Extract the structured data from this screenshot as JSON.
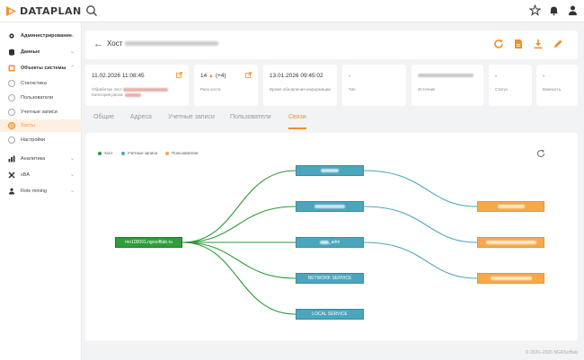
{
  "app": {
    "name": "DATAPLAN"
  },
  "header": {
    "title_prefix": "Хост"
  },
  "sidebar": {
    "items": [
      {
        "label": "Администрирование"
      },
      {
        "label": "Данные"
      },
      {
        "label": "Объекты системы"
      },
      {
        "label": "Статистика"
      },
      {
        "label": "Пользователи"
      },
      {
        "label": "Учетные записи"
      },
      {
        "label": "Хосты"
      },
      {
        "label": "Настройки"
      },
      {
        "label": "Аналитика"
      },
      {
        "label": "xBA"
      },
      {
        "label": "Role mining"
      }
    ]
  },
  "info": {
    "processed": {
      "value": "11.02.2026 11:08:45",
      "label": "Обработан лист",
      "label2": "Категория риска:"
    },
    "risk": {
      "value": "14",
      "delta": "(+4)",
      "label": "Риск хоста"
    },
    "updated": {
      "value": "13.01.2026 09:45:02",
      "label": "Время обновления информации"
    },
    "type": {
      "value": "-",
      "label": "Тип"
    },
    "source": {
      "label": "Источник"
    },
    "status": {
      "value": "-",
      "label": "Статус"
    },
    "importance": {
      "value": "-",
      "label": "Важность"
    }
  },
  "tabs": [
    "Общие",
    "Адреса",
    "Учетные записи",
    "Пользователи",
    "Связи"
  ],
  "graph": {
    "legend": [
      "Хост",
      "Учетные записи",
      "Пользователи"
    ],
    "host_node": "mn100091.ngrsoftlab.ru",
    "account_nodes": [
      "",
      "",
      "_adm",
      "NETWORK SERVICE",
      "LOCAL SERVICE"
    ],
    "colors": {
      "host": "#2e9d3a",
      "account": "#4ba5bd",
      "user": "#f7a84a",
      "accent": "#f0902a"
    }
  },
  "footer": "© 2020–2026 NGRSoftlab"
}
